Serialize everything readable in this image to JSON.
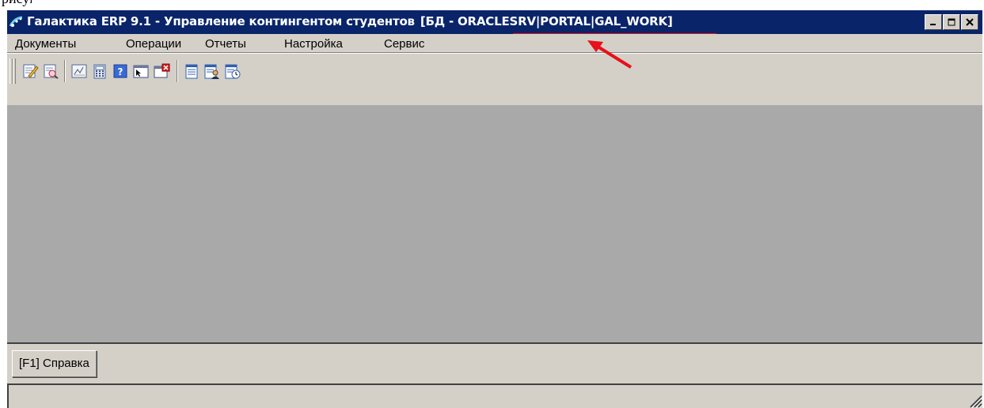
{
  "page_fragment": "рисунку)",
  "window": {
    "title_main": "Галактика ERP 9.1 - Управление контингентом студентов",
    "title_db": "[БД - ORACLESRV|PORTAL|GAL_WORK]",
    "controls": {
      "minimize": "_",
      "maximize": "□",
      "close": "×"
    }
  },
  "menu": {
    "items": [
      {
        "label": "Документы"
      },
      {
        "label": "Операции"
      },
      {
        "label": "Отчеты"
      },
      {
        "label": "Настройка"
      },
      {
        "label": "Сервис"
      }
    ]
  },
  "toolbar": {
    "buttons": [
      {
        "icon": "edit-doc-icon"
      },
      {
        "icon": "view-doc-icon"
      },
      {
        "icon": "formula-icon"
      },
      {
        "icon": "calculator-icon"
      },
      {
        "icon": "help-icon"
      },
      {
        "icon": "select-window-icon"
      },
      {
        "icon": "close-window-icon"
      },
      {
        "icon": "report-icon"
      },
      {
        "icon": "user-report-icon"
      },
      {
        "icon": "scheduled-report-icon"
      }
    ]
  },
  "status": {
    "help_button": "[F1] Справка"
  },
  "colors": {
    "titlebar": "#0a246a",
    "workspace": "#a9a9a9",
    "chrome": "#d4d0c8",
    "annotation": "#e8101a"
  }
}
